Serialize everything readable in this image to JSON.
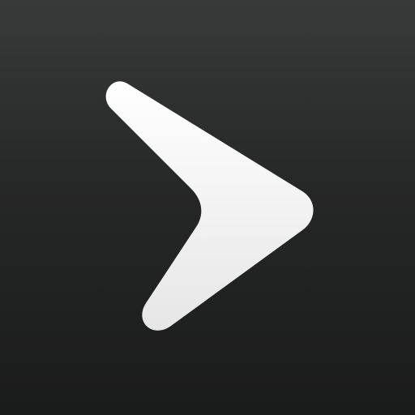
{
  "icon": {
    "name": "play-chevron-icon",
    "colors": {
      "background_top": "#383a3a",
      "background_bottom": "#1a1b1b",
      "glyph": "#ffffff",
      "glyph_shade": "#e6e6e6"
    }
  }
}
